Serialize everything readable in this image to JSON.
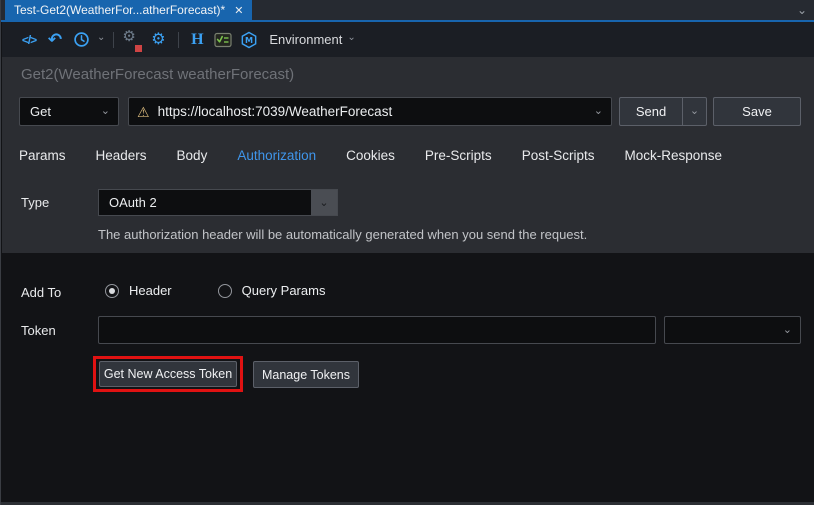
{
  "titlebar": {
    "tab_title": "Test-Get2(WeatherFor...atherForecast)*",
    "close_glyph": "✕",
    "overflow_chevron": "⌄"
  },
  "toolbar": {
    "environment_label": "Environment",
    "icons": {
      "code_glyph": "</>",
      "undo_glyph": "↶",
      "history": "clock-icon",
      "dropdown_chevron": "⌄",
      "extension_gear_glyph": "⚙",
      "gear_glyph": "⚙",
      "http_glyph": "H",
      "env_vars": "checklist-icon",
      "mock_hexagon_letter": "M"
    }
  },
  "request": {
    "name": "Get2(WeatherForecast weatherForecast)",
    "method": "Get",
    "url": "https://localhost:7039/WeatherForecast",
    "warning_glyph": "⚠",
    "send_label": "Send",
    "save_label": "Save",
    "chevron_glyph": "⌄"
  },
  "tabs": {
    "items": [
      {
        "label": "Params",
        "active": false
      },
      {
        "label": "Headers",
        "active": false
      },
      {
        "label": "Body",
        "active": false
      },
      {
        "label": "Authorization",
        "active": true
      },
      {
        "label": "Cookies",
        "active": false
      },
      {
        "label": "Pre-Scripts",
        "active": false
      },
      {
        "label": "Post-Scripts",
        "active": false
      },
      {
        "label": "Mock-Response",
        "active": false
      }
    ]
  },
  "auth": {
    "type_label": "Type",
    "type_value": "OAuth 2",
    "helper_text": "The authorization header will be automatically generated when you send the request.",
    "add_to_label": "Add To",
    "add_to_options": [
      {
        "label": "Header",
        "selected": true
      },
      {
        "label": "Query Params",
        "selected": false
      }
    ],
    "token_label": "Token",
    "token_value": "",
    "token_type_value": "",
    "get_token_button": "Get New Access Token",
    "manage_tokens_button": "Manage Tokens"
  },
  "colors": {
    "accent_blue": "#3ba1f3",
    "tab_blue": "#1865ae",
    "active_tab_text": "#3f95ea",
    "highlight_red": "#e01212",
    "warning_yellow": "#d9b97c",
    "icon_green": "#7cc24e",
    "panel_light": "#2b2d32",
    "panel_dark": "#121316"
  }
}
